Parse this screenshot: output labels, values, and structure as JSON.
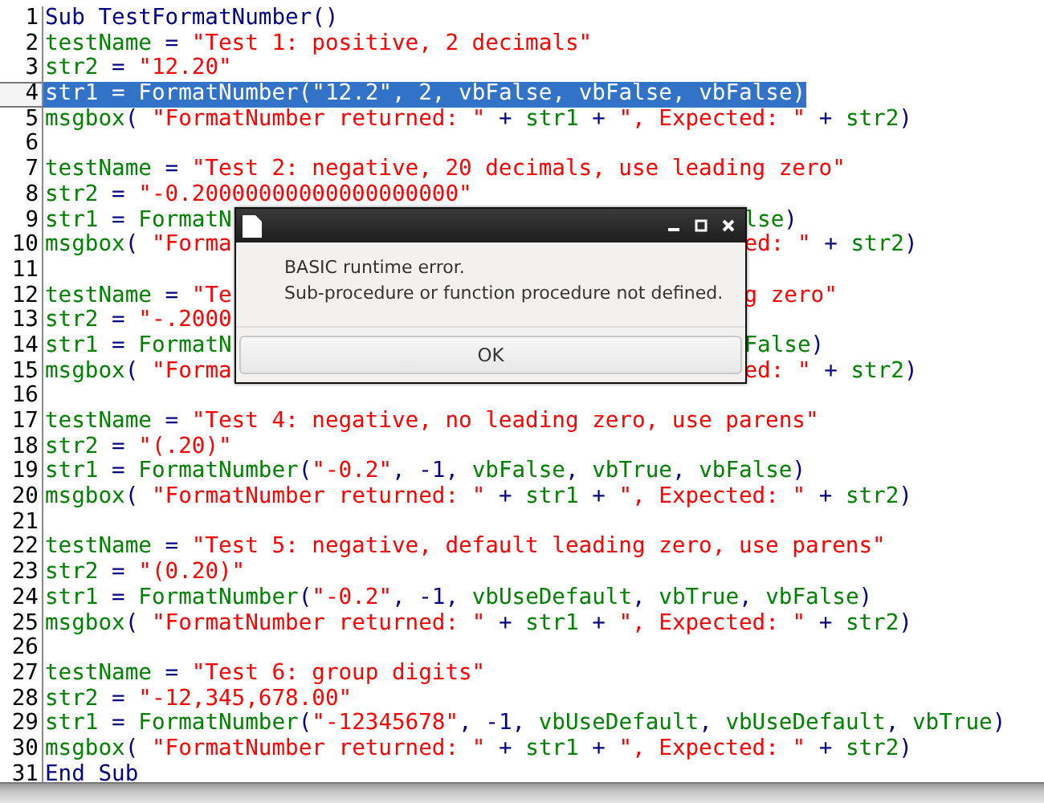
{
  "editor": {
    "lines": [
      {
        "number": "1",
        "selected": false,
        "tokens": [
          {
            "kind": "kw",
            "text": "Sub TestFormatNumber()"
          }
        ]
      },
      {
        "number": "2",
        "selected": false,
        "tokens": [
          {
            "kind": "id",
            "text": "testName"
          },
          {
            "kind": "op",
            "text": " = "
          },
          {
            "kind": "str",
            "text": "\"Test 1: positive, 2 decimals\""
          }
        ]
      },
      {
        "number": "3",
        "selected": false,
        "tokens": [
          {
            "kind": "id",
            "text": "str2"
          },
          {
            "kind": "op",
            "text": " = "
          },
          {
            "kind": "str",
            "text": "\"12.20\""
          }
        ]
      },
      {
        "number": "4",
        "selected": true,
        "tokens": [
          {
            "kind": "id",
            "text": "str1"
          },
          {
            "kind": "op",
            "text": " = "
          },
          {
            "kind": "id",
            "text": "FormatNumber"
          },
          {
            "kind": "op",
            "text": "("
          },
          {
            "kind": "str",
            "text": "\"12.2\""
          },
          {
            "kind": "op",
            "text": ", 2, "
          },
          {
            "kind": "id",
            "text": "vbFalse"
          },
          {
            "kind": "op",
            "text": ", "
          },
          {
            "kind": "id",
            "text": "vbFalse"
          },
          {
            "kind": "op",
            "text": ", "
          },
          {
            "kind": "id",
            "text": "vbFalse"
          },
          {
            "kind": "op",
            "text": ")"
          }
        ]
      },
      {
        "number": "5",
        "selected": false,
        "tokens": [
          {
            "kind": "id",
            "text": "msgbox"
          },
          {
            "kind": "op",
            "text": "( "
          },
          {
            "kind": "str",
            "text": "\"FormatNumber returned: \""
          },
          {
            "kind": "op",
            "text": " + "
          },
          {
            "kind": "id",
            "text": "str1"
          },
          {
            "kind": "op",
            "text": " + "
          },
          {
            "kind": "str",
            "text": "\", Expected: \""
          },
          {
            "kind": "op",
            "text": " + "
          },
          {
            "kind": "id",
            "text": "str2"
          },
          {
            "kind": "op",
            "text": ")"
          }
        ]
      },
      {
        "number": "6",
        "selected": false
      },
      {
        "number": "7",
        "selected": false,
        "tokens": [
          {
            "kind": "id",
            "text": "testName"
          },
          {
            "kind": "op",
            "text": " = "
          },
          {
            "kind": "str",
            "text": "\"Test 2: negative, 20 decimals, use leading zero\""
          }
        ]
      },
      {
        "number": "8",
        "selected": false,
        "tokens": [
          {
            "kind": "id",
            "text": "str2"
          },
          {
            "kind": "op",
            "text": " = "
          },
          {
            "kind": "str",
            "text": "\"-0.20000000000000000000\""
          }
        ]
      },
      {
        "number": "9",
        "selected": false,
        "tokens": [
          {
            "kind": "id",
            "text": "str1"
          },
          {
            "kind": "op",
            "text": " = "
          },
          {
            "kind": "id",
            "text": "FormatN"
          }
        ],
        "after": [
          {
            "kind": "id",
            "text": "lse"
          },
          {
            "kind": "op",
            "text": ")"
          }
        ]
      },
      {
        "number": "10",
        "selected": false,
        "tokens": [
          {
            "kind": "id",
            "text": "msgbox"
          },
          {
            "kind": "op",
            "text": "( "
          },
          {
            "kind": "str",
            "text": "\"Forma"
          }
        ],
        "after": [
          {
            "kind": "str",
            "text": "ed: \""
          },
          {
            "kind": "op",
            "text": " + "
          },
          {
            "kind": "id",
            "text": "str2"
          },
          {
            "kind": "op",
            "text": ")"
          }
        ]
      },
      {
        "number": "11",
        "selected": false
      },
      {
        "number": "12",
        "selected": false,
        "tokens": [
          {
            "kind": "id",
            "text": "testName"
          },
          {
            "kind": "op",
            "text": " = "
          },
          {
            "kind": "str",
            "text": "\"Te"
          }
        ],
        "after": [
          {
            "kind": "str",
            "text": "g zero\""
          }
        ]
      },
      {
        "number": "13",
        "selected": false,
        "tokens": [
          {
            "kind": "id",
            "text": "str2"
          },
          {
            "kind": "op",
            "text": " = "
          },
          {
            "kind": "str",
            "text": "\"-.2000"
          }
        ]
      },
      {
        "number": "14",
        "selected": false,
        "tokens": [
          {
            "kind": "id",
            "text": "str1"
          },
          {
            "kind": "op",
            "text": " = "
          },
          {
            "kind": "id",
            "text": "FormatN"
          }
        ],
        "after": [
          {
            "kind": "id",
            "text": "False"
          },
          {
            "kind": "op",
            "text": ")"
          }
        ]
      },
      {
        "number": "15",
        "selected": false,
        "tokens": [
          {
            "kind": "id",
            "text": "msgbox"
          },
          {
            "kind": "op",
            "text": "( "
          },
          {
            "kind": "str",
            "text": "\"Forma"
          }
        ],
        "after": [
          {
            "kind": "str",
            "text": "ed: \""
          },
          {
            "kind": "op",
            "text": " + "
          },
          {
            "kind": "id",
            "text": "str2"
          },
          {
            "kind": "op",
            "text": ")"
          }
        ]
      },
      {
        "number": "16",
        "selected": false
      },
      {
        "number": "17",
        "selected": false,
        "tokens": [
          {
            "kind": "id",
            "text": "testName"
          },
          {
            "kind": "op",
            "text": " = "
          },
          {
            "kind": "str",
            "text": "\"Test 4: negative, no leading zero, use parens\""
          }
        ]
      },
      {
        "number": "18",
        "selected": false,
        "tokens": [
          {
            "kind": "id",
            "text": "str2"
          },
          {
            "kind": "op",
            "text": " = "
          },
          {
            "kind": "str",
            "text": "\"(.20)\""
          }
        ]
      },
      {
        "number": "19",
        "selected": false,
        "tokens": [
          {
            "kind": "id",
            "text": "str1"
          },
          {
            "kind": "op",
            "text": " = "
          },
          {
            "kind": "id",
            "text": "FormatNumber"
          },
          {
            "kind": "op",
            "text": "("
          },
          {
            "kind": "str",
            "text": "\"-0.2\""
          },
          {
            "kind": "op",
            "text": ", -1, "
          },
          {
            "kind": "id",
            "text": "vbFalse"
          },
          {
            "kind": "op",
            "text": ", "
          },
          {
            "kind": "id",
            "text": "vbTrue"
          },
          {
            "kind": "op",
            "text": ", "
          },
          {
            "kind": "id",
            "text": "vbFalse"
          },
          {
            "kind": "op",
            "text": ")"
          }
        ]
      },
      {
        "number": "20",
        "selected": false,
        "tokens": [
          {
            "kind": "id",
            "text": "msgbox"
          },
          {
            "kind": "op",
            "text": "( "
          },
          {
            "kind": "str",
            "text": "\"FormatNumber returned: \""
          },
          {
            "kind": "op",
            "text": " + "
          },
          {
            "kind": "id",
            "text": "str1"
          },
          {
            "kind": "op",
            "text": " + "
          },
          {
            "kind": "str",
            "text": "\", Expected: \""
          },
          {
            "kind": "op",
            "text": " + "
          },
          {
            "kind": "id",
            "text": "str2"
          },
          {
            "kind": "op",
            "text": ")"
          }
        ]
      },
      {
        "number": "21",
        "selected": false
      },
      {
        "number": "22",
        "selected": false,
        "tokens": [
          {
            "kind": "id",
            "text": "testName"
          },
          {
            "kind": "op",
            "text": " = "
          },
          {
            "kind": "str",
            "text": "\"Test 5: negative, default leading zero, use parens\""
          }
        ]
      },
      {
        "number": "23",
        "selected": false,
        "tokens": [
          {
            "kind": "id",
            "text": "str2"
          },
          {
            "kind": "op",
            "text": " = "
          },
          {
            "kind": "str",
            "text": "\"(0.20)\""
          }
        ]
      },
      {
        "number": "24",
        "selected": false,
        "tokens": [
          {
            "kind": "id",
            "text": "str1"
          },
          {
            "kind": "op",
            "text": " = "
          },
          {
            "kind": "id",
            "text": "FormatNumber"
          },
          {
            "kind": "op",
            "text": "("
          },
          {
            "kind": "str",
            "text": "\"-0.2\""
          },
          {
            "kind": "op",
            "text": ", -1, "
          },
          {
            "kind": "id",
            "text": "vbUseDefault"
          },
          {
            "kind": "op",
            "text": ", "
          },
          {
            "kind": "id",
            "text": "vbTrue"
          },
          {
            "kind": "op",
            "text": ", "
          },
          {
            "kind": "id",
            "text": "vbFalse"
          },
          {
            "kind": "op",
            "text": ")"
          }
        ]
      },
      {
        "number": "25",
        "selected": false,
        "tokens": [
          {
            "kind": "id",
            "text": "msgbox"
          },
          {
            "kind": "op",
            "text": "( "
          },
          {
            "kind": "str",
            "text": "\"FormatNumber returned: \""
          },
          {
            "kind": "op",
            "text": " + "
          },
          {
            "kind": "id",
            "text": "str1"
          },
          {
            "kind": "op",
            "text": " + "
          },
          {
            "kind": "str",
            "text": "\", Expected: \""
          },
          {
            "kind": "op",
            "text": " + "
          },
          {
            "kind": "id",
            "text": "str2"
          },
          {
            "kind": "op",
            "text": ")"
          }
        ]
      },
      {
        "number": "26",
        "selected": false
      },
      {
        "number": "27",
        "selected": false,
        "tokens": [
          {
            "kind": "id",
            "text": "testName"
          },
          {
            "kind": "op",
            "text": " = "
          },
          {
            "kind": "str",
            "text": "\"Test 6: group digits\""
          }
        ]
      },
      {
        "number": "28",
        "selected": false,
        "tokens": [
          {
            "kind": "id",
            "text": "str2"
          },
          {
            "kind": "op",
            "text": " = "
          },
          {
            "kind": "str",
            "text": "\"-12,345,678.00\""
          }
        ]
      },
      {
        "number": "29",
        "selected": false,
        "tokens": [
          {
            "kind": "id",
            "text": "str1"
          },
          {
            "kind": "op",
            "text": " = "
          },
          {
            "kind": "id",
            "text": "FormatNumber"
          },
          {
            "kind": "op",
            "text": "("
          },
          {
            "kind": "str",
            "text": "\"-12345678\""
          },
          {
            "kind": "op",
            "text": ", -1, "
          },
          {
            "kind": "id",
            "text": "vbUseDefault"
          },
          {
            "kind": "op",
            "text": ", "
          },
          {
            "kind": "id",
            "text": "vbUseDefault"
          },
          {
            "kind": "op",
            "text": ", "
          },
          {
            "kind": "id",
            "text": "vbTrue"
          },
          {
            "kind": "op",
            "text": ")"
          }
        ]
      },
      {
        "number": "30",
        "selected": false,
        "tokens": [
          {
            "kind": "id",
            "text": "msgbox"
          },
          {
            "kind": "op",
            "text": "( "
          },
          {
            "kind": "str",
            "text": "\"FormatNumber returned: \""
          },
          {
            "kind": "op",
            "text": " + "
          },
          {
            "kind": "id",
            "text": "str1"
          },
          {
            "kind": "op",
            "text": " + "
          },
          {
            "kind": "str",
            "text": "\", Expected: \""
          },
          {
            "kind": "op",
            "text": " + "
          },
          {
            "kind": "id",
            "text": "str2"
          },
          {
            "kind": "op",
            "text": ")"
          }
        ]
      },
      {
        "number": "31",
        "selected": false,
        "tokens": [
          {
            "kind": "kw",
            "text": "End Sub"
          }
        ]
      }
    ]
  },
  "dialog": {
    "message_lines": [
      "BASIC runtime error.",
      "Sub-procedure or function procedure not defined."
    ],
    "button": "OK"
  }
}
